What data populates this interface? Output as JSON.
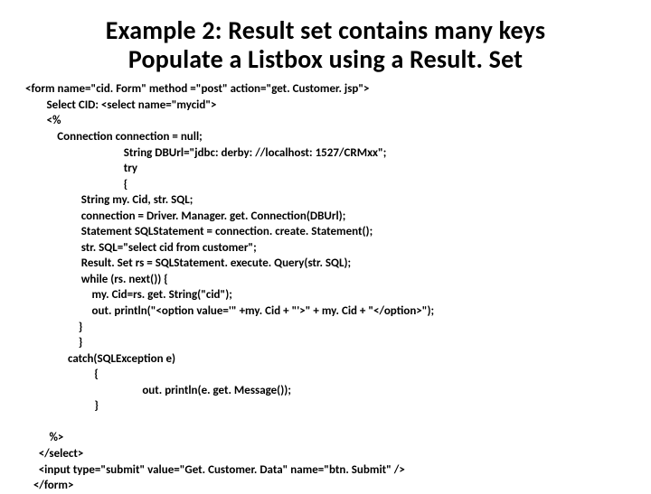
{
  "title_line1": "Example 2: Result set contains many keys",
  "title_line2": "Populate a Listbox using a Result. Set",
  "code": "<form name=\"cid. Form\" method =\"post\" action=\"get. Customer. jsp\">\n        Select CID: <select name=\"mycid\">\n        <%\n            Connection connection = null;\n                                     String DBUrl=\"jdbc: derby: //localhost: 1527/CRMxx\";\n                                     try\n                                     {\n                     String my. Cid, str. SQL;\n                     connection = Driver. Manager. get. Connection(DBUrl);\n                     Statement SQLStatement = connection. create. Statement();\n                     str. SQL=\"select cid from customer\";\n                     Result. Set rs = SQLStatement. execute. Query(str. SQL);\n                     while (rs. next()) {\n                         my. Cid=rs. get. String(\"cid\");\n                         out. println(\"<option value='\" +my. Cid + \"'>\" + my. Cid + \"</option>\");\n                    }\n                    }\n                catch(SQLException e)\n                          {\n                                            out. println(e. get. Message());\n                          }\n\n         %>\n     </select>\n     <input type=\"submit\" value=\"Get. Customer. Data\" name=\"btn. Submit\" />\n   </form>"
}
